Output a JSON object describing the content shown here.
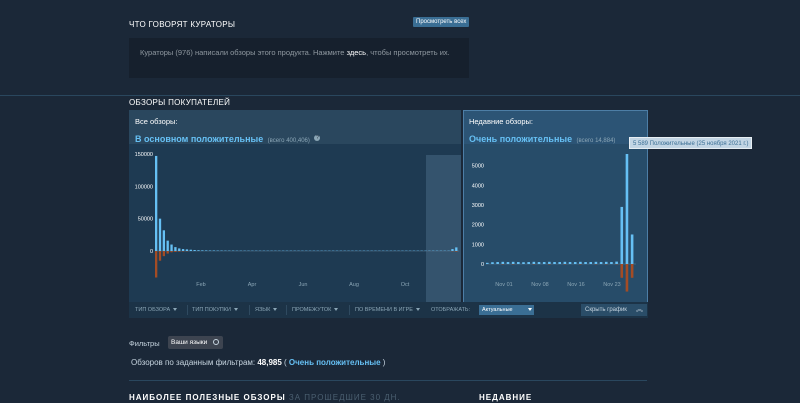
{
  "curators": {
    "title": "ЧТО ГОВОРЯТ КУРАТОРЫ",
    "see_all": "Просмотреть всех",
    "text_before": "Кураторы (976) написали обзоры этого продукта. Нажмите ",
    "link": "здесь",
    "text_after": ", чтобы просмотреть их."
  },
  "reviews": {
    "title": "ОБЗОРЫ ПОКУПАТЕЛЕЙ",
    "all": {
      "label": "Все обзоры:",
      "summary": "В основном положительные",
      "count": "(всего 400,406)"
    },
    "recent": {
      "label": "Недавние обзоры:",
      "summary": "Очень положительные",
      "count": "(всего 14,884)"
    },
    "tooltip": "5 589 Положительные (25 ноября 2021 г.)"
  },
  "chart_data": [
    {
      "type": "bar",
      "name": "all-reviews-histogram",
      "ylim": [
        -40000,
        150000
      ],
      "y_ticks": [
        "150000",
        "100000",
        "50000",
        "0"
      ],
      "x_ticks": [
        "Feb",
        "Apr",
        "Jun",
        "Aug",
        "Oct"
      ],
      "series": [
        {
          "name": "positive",
          "color": "#66c0f4",
          "values": [
            147000,
            50000,
            32000,
            16000,
            10000,
            6000,
            4000,
            3000,
            2500,
            2000,
            1500,
            1200,
            1000,
            900,
            800,
            800,
            700,
            700,
            600,
            600,
            600,
            500,
            500,
            500,
            500,
            500,
            500,
            500,
            500,
            500,
            500,
            500,
            500,
            500,
            500,
            500,
            500,
            500,
            500,
            500,
            500,
            500,
            500,
            500,
            500,
            500,
            500,
            500,
            500,
            500,
            500,
            500,
            500,
            500,
            500,
            500,
            500,
            500,
            500,
            500,
            500,
            500,
            500,
            500,
            500,
            500,
            500,
            500,
            500,
            500,
            500,
            500,
            500,
            500,
            500,
            500,
            500,
            3000,
            5589
          ]
        },
        {
          "name": "negative",
          "color": "#a34c25",
          "values": [
            -41000,
            -15000,
            -8000,
            -4000,
            -2000,
            -1500,
            -1000,
            -700,
            -500,
            -400,
            -300,
            -200,
            -200,
            -150,
            -150,
            -100,
            -100,
            -100,
            -100,
            -100,
            -100,
            -100,
            -100,
            -100,
            -100,
            -100,
            -100,
            -100,
            -100,
            -100,
            -100,
            -100,
            -100,
            -100,
            -100,
            -100,
            -100,
            -100,
            -100,
            -100,
            -100,
            -100,
            -100,
            -100,
            -100,
            -100,
            -100,
            -100,
            -100,
            -100,
            -100,
            -100,
            -100,
            -100,
            -100,
            -100,
            -100,
            -100,
            -100,
            -100,
            -100,
            -100,
            -100,
            -100,
            -100,
            -100,
            -100,
            -100,
            -100,
            -100,
            -100,
            -100,
            -100,
            -100,
            -100,
            -100,
            -100,
            -500,
            -1000
          ]
        }
      ]
    },
    {
      "type": "bar",
      "name": "recent-reviews-histogram",
      "ylim": [
        -1400,
        5589
      ],
      "y_ticks": [
        "5000",
        "4000",
        "3000",
        "2000",
        "1000",
        "0"
      ],
      "x_ticks": [
        "Nov 01",
        "Nov 08",
        "Nov 16",
        "Nov 23"
      ],
      "series": [
        {
          "name": "positive",
          "color": "#66c0f4",
          "values": [
            60,
            90,
            100,
            110,
            100,
            110,
            100,
            90,
            100,
            110,
            100,
            100,
            110,
            100,
            100,
            110,
            100,
            100,
            110,
            100,
            100,
            110,
            100,
            110,
            100,
            120,
            2900,
            5589,
            1500
          ]
        },
        {
          "name": "negative",
          "color": "#a34c25",
          "values": [
            -10,
            -15,
            -15,
            -20,
            -15,
            -20,
            -15,
            -15,
            -15,
            -20,
            -15,
            -15,
            -20,
            -15,
            -15,
            -20,
            -15,
            -15,
            -20,
            -15,
            -15,
            -20,
            -15,
            -20,
            -15,
            -20,
            -700,
            -1400,
            -700
          ]
        }
      ]
    }
  ],
  "filterbar": {
    "review_type": "ТИП ОБЗОРА",
    "purchase_type": "ТИП ПОКУПКИ",
    "language": "ЯЗЫК",
    "date_range": "ПРОМЕЖУТОК",
    "playtime": "ПО ВРЕМЕНИ В ИГРЕ",
    "display_label": "ОТОБРАЖАТЬ:",
    "display_value": "Актуальные",
    "hide_graph": "Скрыть график"
  },
  "filters": {
    "label": "Фильтры",
    "language_chip": "Ваши языки",
    "count_prefix": "Обзоров по заданным фильтрам: ",
    "count_value": "48,985",
    "count_open": " ( ",
    "count_summary": "Очень положительные",
    "count_close": " )"
  },
  "sections": {
    "most_helpful": "НАИБОЛЕЕ ПОЛЕЗНЫЕ ОБЗОРЫ",
    "most_helpful_period": "ЗА ПРОШЕДШИЕ 30 ДН.",
    "recent": "НЕДАВНИЕ"
  }
}
